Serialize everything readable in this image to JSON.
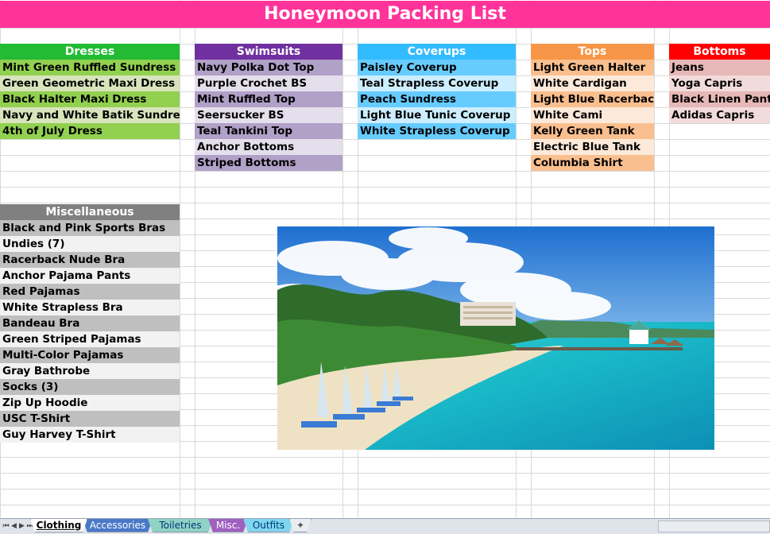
{
  "title": "Honeymoon Packing List",
  "columns": [
    {
      "header": "Dresses",
      "items": [
        "Mint Green Ruffled Sundress",
        "Green Geometric Maxi Dress",
        "Black Halter Maxi Dress",
        "Navy and White Batik Sundress",
        "4th of July Dress"
      ]
    },
    {
      "header": "Swimsuits",
      "items": [
        "Navy Polka Dot Top",
        "Purple Crochet  BS",
        "Mint Ruffled Top",
        "Seersucker BS",
        "Teal Tankini Top",
        "Anchor Bottoms",
        "Striped Bottoms"
      ]
    },
    {
      "header": "Coverups",
      "items": [
        "Paisley Coverup",
        "Teal Strapless Coverup",
        "Peach Sundress",
        "Light Blue Tunic Coverup",
        "White Strapless Coverup"
      ]
    },
    {
      "header": "Tops",
      "items": [
        "Light Green Halter",
        "White Cardigan",
        "Light Blue Racerback",
        "White Cami",
        "Kelly Green Tank",
        "Electric Blue Tank",
        "Columbia Shirt"
      ]
    },
    {
      "header": "Bottoms",
      "items": [
        "Jeans",
        "Yoga Capris",
        "Black Linen Pants",
        "Adidas Capris"
      ]
    }
  ],
  "misc": {
    "header": "Miscellaneous",
    "items": [
      "Black and Pink Sports Bras",
      "Undies (7)",
      "Racerback Nude Bra",
      "Anchor Pajama Pants",
      "Red Pajamas",
      "White Strapless Bra",
      "Bandeau Bra",
      "Green Striped Pajamas",
      "Multi-Color Pajamas",
      "Gray Bathrobe",
      "Socks (3)",
      "Zip Up Hoodie",
      "USC T-Shirt",
      "Guy Harvey T-Shirt"
    ]
  },
  "tabs": [
    "Clothing",
    "Accessories",
    "Toiletries",
    "Misc.",
    "Outfits"
  ],
  "colors": {
    "title": "#ff3399",
    "dresses": "#33cc33",
    "swimsuits": "#7030a0",
    "coverups": "#33ccff",
    "tops": "#f79646",
    "bottoms": "#ff0000",
    "misc": "#808080"
  },
  "photo_icon": "beach-resort-photo"
}
